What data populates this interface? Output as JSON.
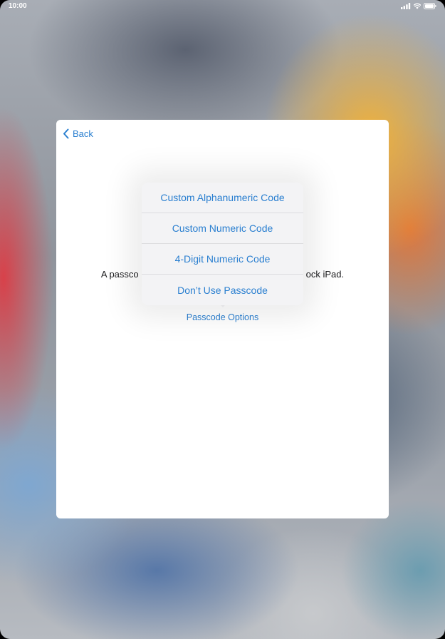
{
  "status_bar": {
    "time": "10:00",
    "icons": [
      "signal-icon",
      "wifi-icon",
      "battery-icon"
    ]
  },
  "modal": {
    "back_label": "Back",
    "description_left": "A passco",
    "description_right": "ock iPad.",
    "passcode_options_label": "Passcode Options"
  },
  "popover": {
    "items": [
      {
        "label": "Custom Alphanumeric Code"
      },
      {
        "label": "Custom Numeric Code"
      },
      {
        "label": "4-Digit Numeric Code"
      },
      {
        "label": "Don’t Use Passcode"
      }
    ]
  },
  "colors": {
    "accent": "#2a7fd0",
    "popover_bg": "#f3f3f5",
    "modal_bg": "#ffffff"
  }
}
